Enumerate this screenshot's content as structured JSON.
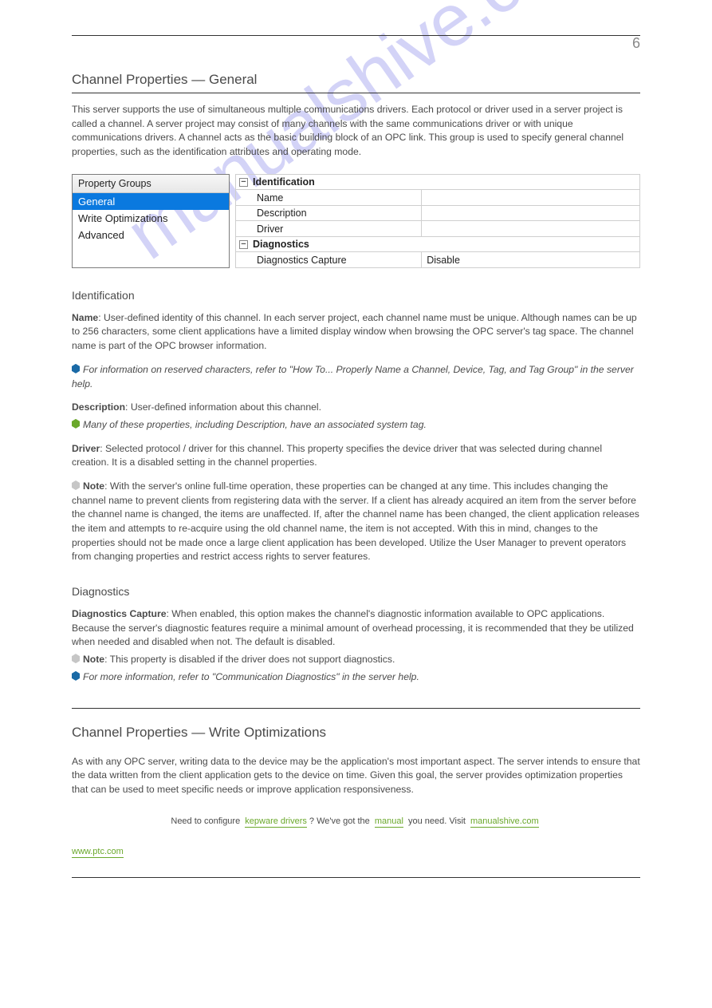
{
  "header": {
    "page_number": "6"
  },
  "section": {
    "title": "Channel Properties — General",
    "intro": "This server supports the use of simultaneous multiple communications drivers. Each protocol or driver used in a server project is called a channel. A server project may consist of many channels with the same communications driver or with unique communications drivers. A channel acts as the basic building block of an OPC link. This group is used to specify general channel properties, such as the identification attributes and operating mode."
  },
  "prop_groups": {
    "header": "Property Groups",
    "items": [
      "General",
      "Write Optimizations",
      "Advanced"
    ],
    "selected_index": 0
  },
  "prop_rows": {
    "group1": "Identification",
    "r1_label": "Name",
    "r1_value": "",
    "r2_label": "Description",
    "r2_value": "",
    "r3_label": "Driver",
    "r3_value": "",
    "group2": "Diagnostics",
    "r4_label": "Diagnostics Capture",
    "r4_value": "Disable"
  },
  "identification": {
    "heading": "Identification",
    "name_term": "Name",
    "name_text": ": User-defined identity of this channel. In each server project, each channel name must be unique. Although names can be up to 256 characters, some client applications have a limited display window when browsing the OPC server's tag space. The channel name is part of the OPC browser information.",
    "name_note": "For information on reserved characters, refer to \"How To... Properly Name a Channel, Device, Tag, and Tag Group\" in the server help.",
    "desc_term": "Description",
    "desc_text": ": User-defined information about this channel.",
    "desc_note": "Many of these properties, including Description, have an associated system tag.",
    "driver_term": "Driver",
    "driver_text": ": Selected protocol / driver for this channel. This property specifies the device driver that was selected during channel creation. It is a disabled setting in the channel properties.",
    "driver_note": ": With the server's online full-time operation, these properties can be changed at any time. This includes changing the channel name to prevent clients from registering data with the server. If a client has already acquired an item from the server before the channel name is changed, the items are unaffected. If, after the channel name has been changed, the client application releases the item and attempts to re-acquire using the old channel name, the item is not accepted. With this in mind, changes to the properties should not be made once a large client application has been developed. Utilize the User Manager to prevent operators from changing properties and restrict access rights to server features.",
    "note_label": "Note"
  },
  "diagnostics": {
    "heading": "Diagnostics",
    "term": "Diagnostics Capture",
    "text": ": When enabled, this option makes the channel's diagnostic information available to OPC applications. Because the server's diagnostic features require a minimal amount of overhead processing, it is recommended that they be utilized when needed and disabled when not. The default is disabled.",
    "note1": ": This property is disabled if the driver does not support diagnostics.",
    "note2": "For more information, refer to \"Communication Diagnostics\" in the server help.",
    "note_label": "Note"
  },
  "section2": {
    "title": "Channel Properties — Write Optimizations",
    "text1": "As with any OPC server, writing data to the device may be the application's most important aspect. The server intends to ensure that the data written from the client application gets to the device on time. Given this goal, the server provides optimization properties that can be used to meet specific needs or improve application responsiveness."
  },
  "footer": {
    "lead": "Need to configure ",
    "hl1": "kepware drivers",
    "mid1": "? We've got the ",
    "hl2": "manual",
    "mid2": " you need. Visit ",
    "hl3": "manualshive.com",
    "site": "www.ptc.com"
  },
  "watermark": "manualshive.com"
}
